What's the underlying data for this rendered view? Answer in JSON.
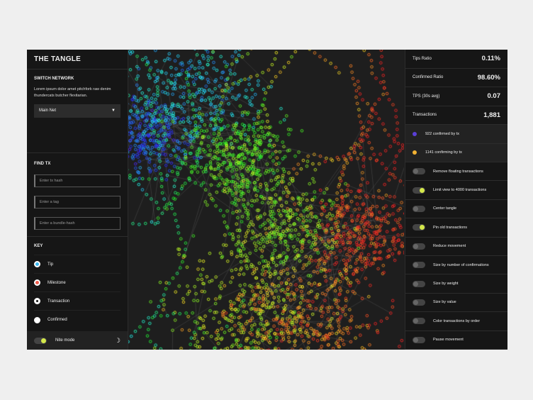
{
  "sidebar": {
    "title": "THE TANGLE",
    "switch_network": {
      "heading": "SWITCH NETWORK",
      "description": "Lorem ipsum dolor amet pitchfork raw denim thundercats butcher flexitarian.",
      "network": "Main Net"
    },
    "find_tx": {
      "heading": "FIND TX",
      "inputs": [
        {
          "placeholder": "Enter tx hash"
        },
        {
          "placeholder": "Enter a tag"
        },
        {
          "placeholder": "Enter a bundle-hash"
        }
      ]
    },
    "key": {
      "heading": "KEY",
      "items": [
        {
          "label": "Tip",
          "color": "#3ab8f0"
        },
        {
          "label": "Milestone",
          "color": "#f05a4a"
        },
        {
          "label": "Transaction",
          "color": "#111111"
        },
        {
          "label": "Confirmed",
          "color": "#ffffff"
        }
      ]
    },
    "nite_mode": {
      "label": "Nite mode",
      "on": true
    }
  },
  "stats": [
    {
      "label": "Tips Ratio",
      "value": "0.11%"
    },
    {
      "label": "Confirmed Ratio",
      "value": "98.60%"
    },
    {
      "label": "TPS (30s avg)",
      "value": "0.07"
    },
    {
      "label": "Transactions",
      "value": "1,881"
    }
  ],
  "legend": [
    {
      "label": "922 confirmed by tx",
      "color": "#5b3fd6"
    },
    {
      "label": "1141 confirming by tx",
      "color": "#f2b233"
    }
  ],
  "options": [
    {
      "label": "Remove floating transactions",
      "on": false
    },
    {
      "label": "Limit view to 4000 transactions",
      "on": true
    },
    {
      "label": "Center tangle",
      "on": false
    },
    {
      "label": "Pin old transactions",
      "on": true
    },
    {
      "label": "Reduce movement",
      "on": false
    },
    {
      "label": "Size by number of confirmations",
      "on": false
    },
    {
      "label": "Size by weight",
      "on": false
    },
    {
      "label": "Size by value",
      "on": false
    },
    {
      "label": "Color transactions by order",
      "on": false
    },
    {
      "label": "Pause movement",
      "on": false
    }
  ]
}
